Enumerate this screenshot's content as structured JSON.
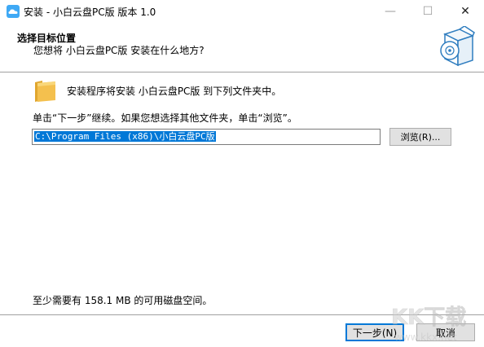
{
  "window": {
    "title": "安装 - 小白云盘PC版 版本 1.0",
    "minimize_glyph": "—",
    "maximize_glyph": "☐",
    "close_glyph": "✕"
  },
  "header": {
    "title": "选择目标位置",
    "subtitle": "您想将 小白云盘PC版 安装在什么地方?"
  },
  "main": {
    "info_text": "安装程序将安装 小白云盘PC版 到下列文件夹中。",
    "instruction_text": "单击“下一步”继续。如果您想选择其他文件夹，单击“浏览”。",
    "install_path": "C:\\Program Files (x86)\\小白云盘PC版",
    "browse_label": "浏览(R)...",
    "disk_space_text": "至少需要有 158.1 MB 的可用磁盘空间。"
  },
  "footer": {
    "next_label": "下一步(N)",
    "cancel_label": "取消"
  },
  "watermark": {
    "text": "KK下载",
    "url": "www.kkx.net"
  },
  "colors": {
    "accent": "#0078d7",
    "app_icon": "#3fa9f5",
    "folder": "#f4c04e"
  },
  "icons": {
    "app": "cloud-app-icon",
    "folder": "folder-icon",
    "header_art": "software-box-disc-icon"
  }
}
